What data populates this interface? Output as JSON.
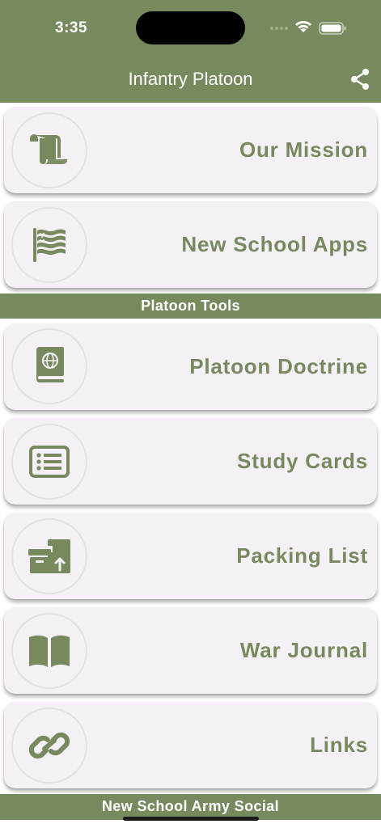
{
  "status_bar": {
    "time": "3:35"
  },
  "header": {
    "title": "Infantry Platoon",
    "share_icon": "share-icon"
  },
  "colors": {
    "brand": "#778a5e",
    "card_bg": "#f4f0f6",
    "text": "#778a5e"
  },
  "top_items": [
    {
      "label": "Our Mission",
      "icon": "scroll-icon"
    },
    {
      "label": "New School Apps",
      "icon": "flag-icon"
    }
  ],
  "sections": {
    "tools": {
      "title": "Platoon Tools"
    },
    "social": {
      "title": "New School Army Social"
    }
  },
  "tool_items": [
    {
      "label": "Platoon Doctrine",
      "icon": "globe-book-icon"
    },
    {
      "label": "Study Cards",
      "icon": "list-card-icon"
    },
    {
      "label": "Packing List",
      "icon": "boxes-upload-icon"
    },
    {
      "label": "War Journal",
      "icon": "open-book-icon"
    },
    {
      "label": "Links",
      "icon": "link-icon"
    }
  ]
}
